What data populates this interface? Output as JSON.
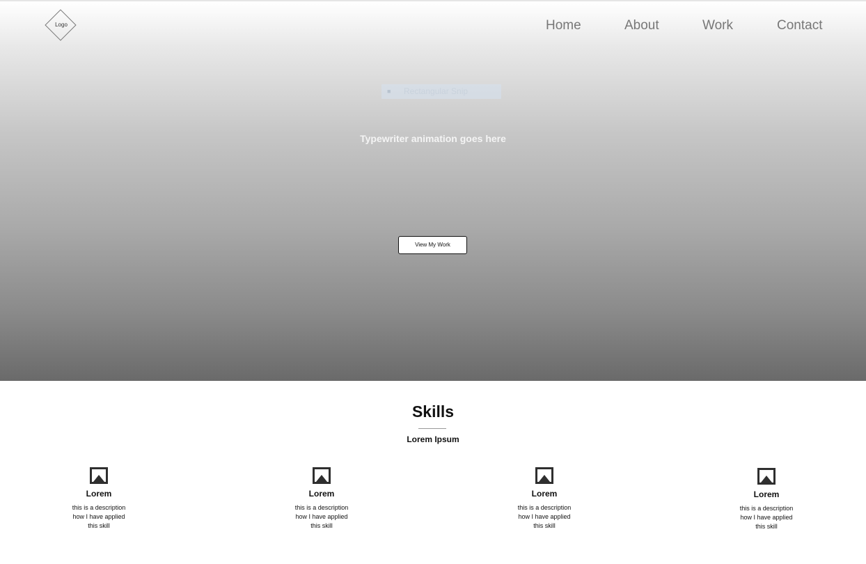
{
  "header": {
    "logo_label": "Logo",
    "nav": {
      "home": "Home",
      "about": "About",
      "work": "Work",
      "contact": "Contact"
    }
  },
  "hero": {
    "snip_overlay_label": "Rectangular Snip",
    "typewriter_text": "Typewriter animation goes here",
    "cta_label": "View My Work"
  },
  "skills": {
    "title": "Skills",
    "subtitle": "Lorem Ipsum",
    "items": [
      {
        "icon": "image-icon",
        "name": "Lorem",
        "desc_lines": [
          "this is a description",
          "how I have applied",
          "this skill"
        ]
      },
      {
        "icon": "image-icon",
        "name": "Lorem",
        "desc_lines": [
          "this is a description",
          "how I have applied",
          "this skill"
        ]
      },
      {
        "icon": "image-icon",
        "name": "Lorem",
        "desc_lines": [
          "this is a description",
          "how I have applied",
          "this skill"
        ]
      },
      {
        "icon": "image-icon",
        "name": "Lorem",
        "desc_lines": [
          "this is a description",
          "how I have applied",
          "this skill"
        ]
      }
    ]
  },
  "colors": {
    "nav_text": "#777777",
    "hero_top": "#ffffff",
    "hero_bottom": "#6a6a6a",
    "text_dark": "#111111"
  }
}
